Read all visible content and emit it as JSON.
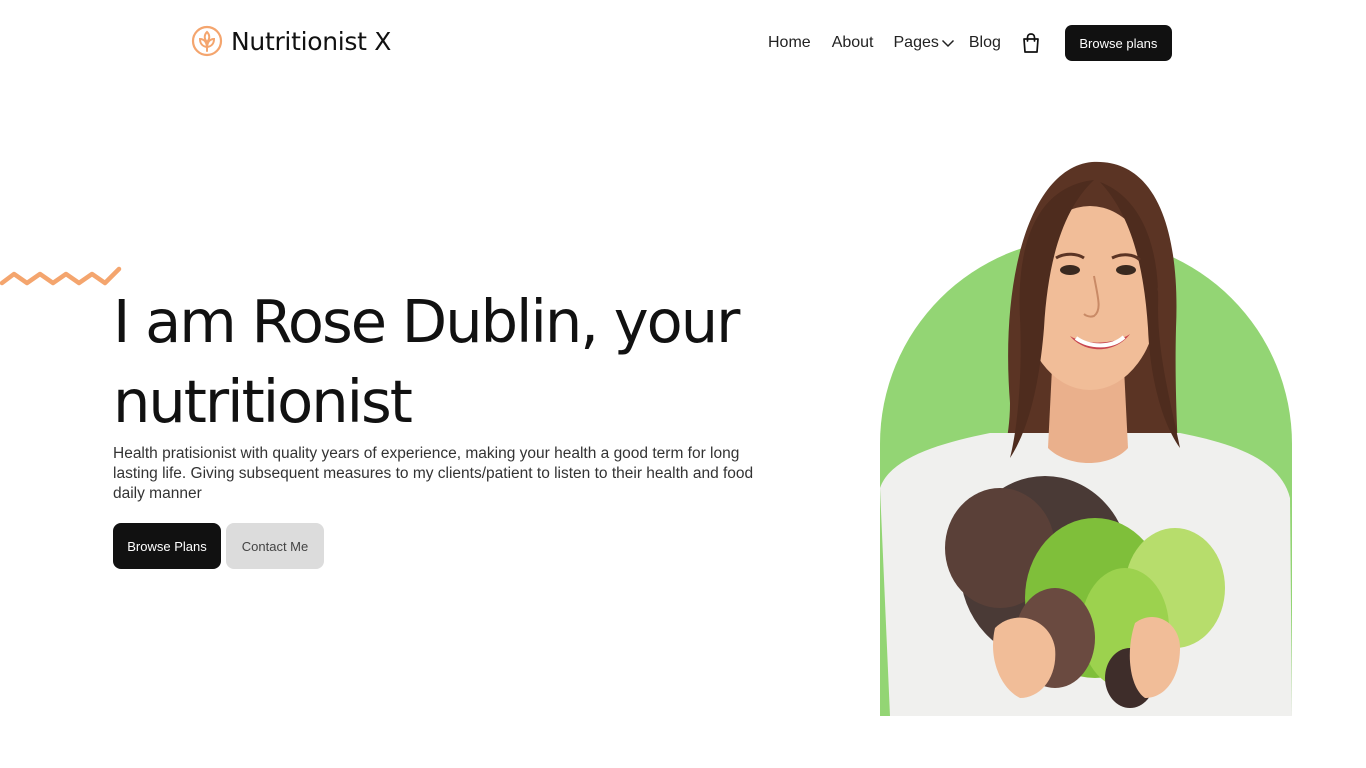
{
  "brand": {
    "name": "Nutritionist X",
    "icon": "leaf-logo-icon",
    "accent_color": "#f4a56e"
  },
  "nav": {
    "home": "Home",
    "about": "About",
    "pages": "Pages",
    "blog": "Blog",
    "cart_icon": "shopping-bag-icon",
    "cta": "Browse plans"
  },
  "hero": {
    "title": "I am Rose Dublin, your nutritionist",
    "description": "Health pratisionist with quality years of experience, making your health a good term for long lasting life. Giving subsequent measures to my clients/patient to listen to their health and food daily manner",
    "primary_button": "Browse Plans",
    "secondary_button": "Contact Me",
    "image_alt": "Smiling woman holding lettuce",
    "arch_color": "#93d574"
  }
}
